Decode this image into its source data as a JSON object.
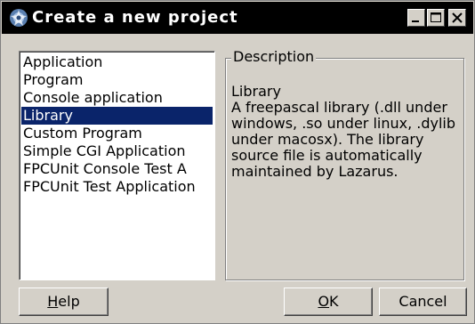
{
  "window": {
    "title": "Create a new project"
  },
  "project_types": {
    "items": [
      {
        "label": "Application",
        "selected": false
      },
      {
        "label": "Program",
        "selected": false
      },
      {
        "label": "Console application",
        "selected": false
      },
      {
        "label": "Library",
        "selected": true
      },
      {
        "label": "Custom Program",
        "selected": false
      },
      {
        "label": "Simple CGI Application",
        "selected": false
      },
      {
        "label": "FPCUnit Console Test A",
        "selected": false
      },
      {
        "label": "FPCUnit Test Application",
        "selected": false
      }
    ]
  },
  "description": {
    "caption": "Description",
    "text": "Library\nA freepascal library (.dll under windows, .so under linux, .dylib under macosx). The library source file is automatically maintained by Lazarus."
  },
  "buttons": {
    "help": {
      "mnemonic": "H",
      "rest": "elp"
    },
    "ok": {
      "mnemonic": "O",
      "rest": "K"
    },
    "cancel": {
      "label": "Cancel"
    }
  },
  "colors": {
    "titlebar": "#000000",
    "face": "#d4d0c8",
    "selection": "#0a246a"
  },
  "icons": {
    "app": "lazarus-icon",
    "minimize": "minimize-icon",
    "maximize": "maximize-icon",
    "close": "close-icon"
  }
}
